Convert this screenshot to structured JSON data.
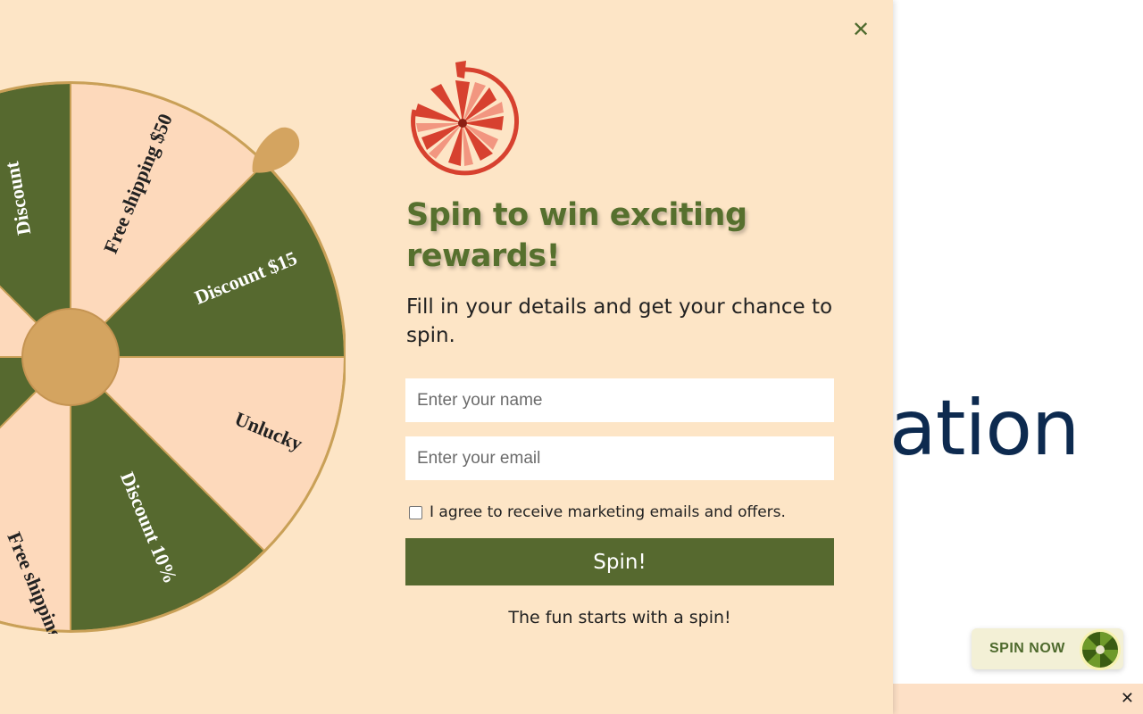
{
  "background": {
    "partial_heading": "ation"
  },
  "popup": {
    "close_icon": "close-icon",
    "logo_icon": "spin-wheel-logo-icon",
    "headline": "Spin to win exciting rewards!",
    "subhead": "Fill in your details and get your chance to spin.",
    "name_placeholder": "Enter your name",
    "email_placeholder": "Enter your email",
    "consent_checked": false,
    "consent_label": "I agree to receive marketing emails and offers.",
    "spin_button_label": "Spin!",
    "footer_note": "The fun starts with a spin!"
  },
  "wheel": {
    "segments": [
      {
        "label": "Free shipping $50",
        "color": "#fdd9bb"
      },
      {
        "label": "Discount $15",
        "color": "#56692f"
      },
      {
        "label": "Unlucky",
        "color": "#fdd9bb"
      },
      {
        "label": "Discount 10%",
        "color": "#56692f"
      },
      {
        "label": "Free shipping",
        "color": "#fdd9bb"
      },
      {
        "label": "Discount",
        "color": "#56692f"
      }
    ],
    "rim_color": "#c9a057",
    "hub_color": "#d4a460"
  },
  "spin_now_widget": {
    "label": "SPIN NOW",
    "icon": "mini-wheel-icon"
  },
  "bottom_bar": {
    "close_icon": "close-icon"
  },
  "colors": {
    "accent_green": "#56692f",
    "panel_bg": "#fde5c6",
    "logo_red": "#d7412f"
  }
}
